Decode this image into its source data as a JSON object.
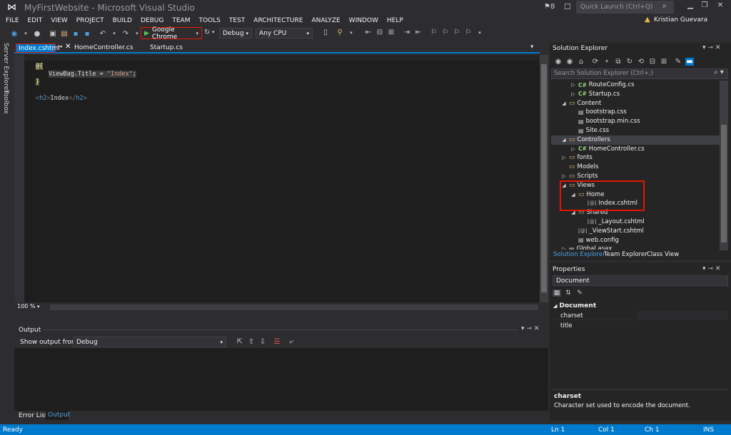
{
  "window": {
    "title": "MyFirstWebsite - Microsoft Visual Studio",
    "notifications": "8",
    "quick_launch_placeholder": "Quick Launch (Ctrl+Q)",
    "user": "Kristian Guevara"
  },
  "menu": [
    "FILE",
    "EDIT",
    "VIEW",
    "PROJECT",
    "BUILD",
    "DEBUG",
    "TEAM",
    "TOOLS",
    "TEST",
    "ARCHITECTURE",
    "ANALYZE",
    "WINDOW",
    "HELP"
  ],
  "toolbar": {
    "run_target": "Google Chrome",
    "configuration": "Debug",
    "platform": "Any CPU"
  },
  "side_tabs": [
    "Server Explorer",
    "Toolbox"
  ],
  "doc_tabs": {
    "active": "Index.cshtml",
    "others": [
      "HomeController.cs",
      "Startup.cs"
    ]
  },
  "editor": {
    "lines": [
      "@{",
      "    ViewBag.Title = \"Index\";",
      "}",
      "",
      "<h2>Index</h2>"
    ],
    "code_tokens": {
      "at": "@{",
      "viewbag": "ViewBag.Title = ",
      "string": "\"Index\"",
      "semi": ";",
      "close": "}",
      "lt": "<",
      "h2open": "h2",
      "gt": ">",
      "text": "Index",
      "ltslash": "</",
      "h2close": "h2",
      "gt2": ">"
    },
    "zoom": "100 %"
  },
  "output": {
    "title": "Output",
    "show_from_label": "Show output from:",
    "source": "Debug"
  },
  "bottom_tabs": [
    "Error List",
    "Output"
  ],
  "solution_explorer": {
    "title": "Solution Explorer",
    "search_placeholder": "Search Solution Explorer (Ctrl+;)",
    "tree": [
      {
        "label": "RouteConfig.cs",
        "type": "cs",
        "level": 3,
        "arrow": "collapsed"
      },
      {
        "label": "Startup.cs",
        "type": "cs",
        "level": 3,
        "arrow": "collapsed"
      },
      {
        "label": "Content",
        "type": "folder",
        "level": 2,
        "arrow": "expanded"
      },
      {
        "label": "bootstrap.css",
        "type": "file",
        "level": 3,
        "arrow": "none"
      },
      {
        "label": "bootstrap.min.css",
        "type": "file",
        "level": 3,
        "arrow": "none"
      },
      {
        "label": "Site.css",
        "type": "file",
        "level": 3,
        "arrow": "none"
      },
      {
        "label": "Controllers",
        "type": "folder",
        "level": 2,
        "arrow": "expanded"
      },
      {
        "label": "HomeController.cs",
        "type": "cs",
        "level": 3,
        "arrow": "collapsed"
      },
      {
        "label": "fonts",
        "type": "folder",
        "level": 2,
        "arrow": "collapsed"
      },
      {
        "label": "Models",
        "type": "folder",
        "level": 2,
        "arrow": "none"
      },
      {
        "label": "Scripts",
        "type": "folder",
        "level": 2,
        "arrow": "collapsed"
      },
      {
        "label": "Views",
        "type": "folder",
        "level": 2,
        "arrow": "expanded"
      },
      {
        "label": "Home",
        "type": "folder",
        "level": 3,
        "arrow": "expanded"
      },
      {
        "label": "Index.cshtml",
        "type": "razor",
        "level": 4,
        "arrow": "none"
      },
      {
        "label": "Shared",
        "type": "folder",
        "level": 3,
        "arrow": "expanded"
      },
      {
        "label": "_Layout.cshtml",
        "type": "razor",
        "level": 4,
        "arrow": "none"
      },
      {
        "label": "_ViewStart.cshtml",
        "type": "razor",
        "level": 3,
        "arrow": "none"
      },
      {
        "label": "web.config",
        "type": "file",
        "level": 3,
        "arrow": "none"
      },
      {
        "label": "Global.asax",
        "type": "file",
        "level": 2,
        "arrow": "collapsed"
      }
    ],
    "tabs": [
      "Solution Explorer",
      "Team Explorer",
      "Class View"
    ]
  },
  "properties": {
    "title": "Properties",
    "object": "Document",
    "category": "Document",
    "rows": [
      "charset",
      "title"
    ],
    "desc_name": "charset",
    "desc_text": "Character set used to encode the document."
  },
  "status": {
    "left": "Ready",
    "ln": "Ln 1",
    "col": "Col 1",
    "ch": "Ch 1",
    "mode": "INS"
  },
  "colors": {
    "accent": "#007acc",
    "highlight_box": "#e51400",
    "background": "#2d2d30",
    "editor_bg": "#1e1e1e"
  }
}
